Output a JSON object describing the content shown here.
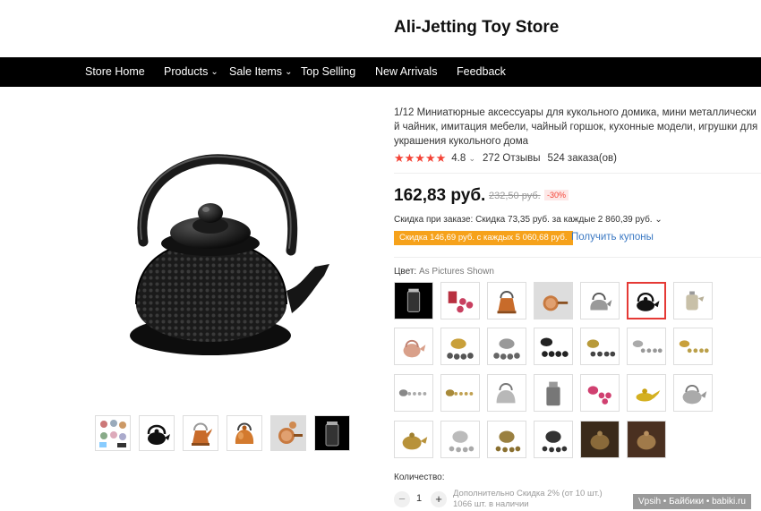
{
  "store": {
    "title": "Ali-Jetting Toy Store"
  },
  "nav": {
    "items": [
      {
        "label": "Store Home",
        "dropdown": false
      },
      {
        "label": "Products",
        "dropdown": true
      },
      {
        "label": "Sale Items",
        "dropdown": true
      },
      {
        "label": "Top Selling",
        "dropdown": false
      },
      {
        "label": "New Arrivals",
        "dropdown": false
      },
      {
        "label": "Feedback",
        "dropdown": false
      }
    ],
    "chevron": "⌄"
  },
  "product": {
    "title": "1/12 Миниатюрные аксессуары для кукольного домика, мини металлический чайник, имитация мебели, чайный горшок, кухонные модели, игрушки для украшения кукольного дома",
    "stars": "★★★★★",
    "rating": "4.8",
    "rating_chevron": "⌄",
    "reviews": "272 Отзывы",
    "orders": "524 заказа(ов)",
    "price": "162,83 руб.",
    "old_price": "232,50 руб.",
    "discount": "-30%",
    "order_discount": "Скидка при заказе: Скидка 73,35 руб. за каждые 2 860,39 руб. ⌄",
    "coupon_tag": "Скидка 146,69 руб. с каждых 5 060,68 руб.",
    "coupon_link": "Получить купоны",
    "color_label": "Цвет:",
    "color_value": "As Pictures Shown",
    "selected_swatch_index": 5,
    "qty_label": "Количество:",
    "qty_minus": "−",
    "qty_plus": "+",
    "qty_value": "1",
    "qty_extra_line1": "Дополнительно Скидка 2% (от 10 шт.)",
    "qty_extra_line2": "1066 шт. в наличии"
  },
  "watermark": "Vpsih • Байбики • babiki.ru",
  "colors": {
    "accent": "#e53935",
    "coupon_bg": "#f6a21b",
    "link": "#3a78c3",
    "nav_bg": "#000000"
  }
}
